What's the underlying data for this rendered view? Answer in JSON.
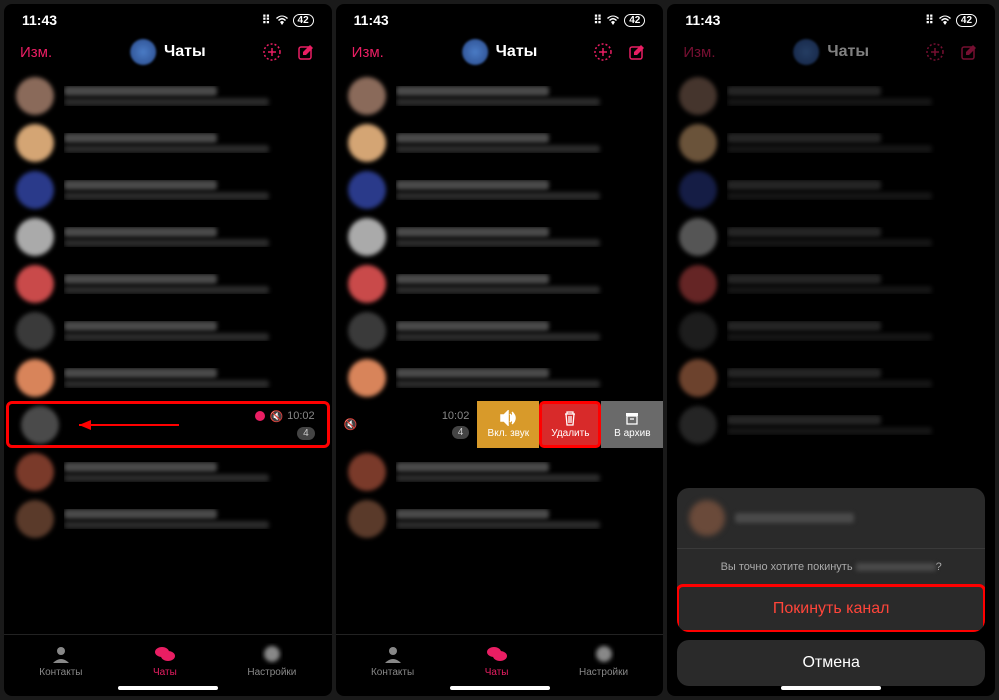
{
  "status": {
    "time": "11:43",
    "signal_icon": "signal",
    "wifi_icon": "wifi",
    "battery": "42"
  },
  "header": {
    "edit_label": "Изм.",
    "title": "Чаты",
    "new_chat_icon": "plus-circle",
    "compose_icon": "compose"
  },
  "highlighted_chat": {
    "time": "10:02",
    "badge": "4"
  },
  "swipe": {
    "time": "10:02",
    "badge": "4",
    "sound_label": "Вкл. звук",
    "delete_label": "Удалить",
    "archive_label": "В архив"
  },
  "tabs": {
    "contacts": "Контакты",
    "chats": "Чаты",
    "settings": "Настройки"
  },
  "sheet": {
    "confirm_text": "Вы точно хотите покинуть",
    "confirm_suffix": "?",
    "leave_label": "Покинуть канал",
    "cancel_label": "Отмена"
  }
}
